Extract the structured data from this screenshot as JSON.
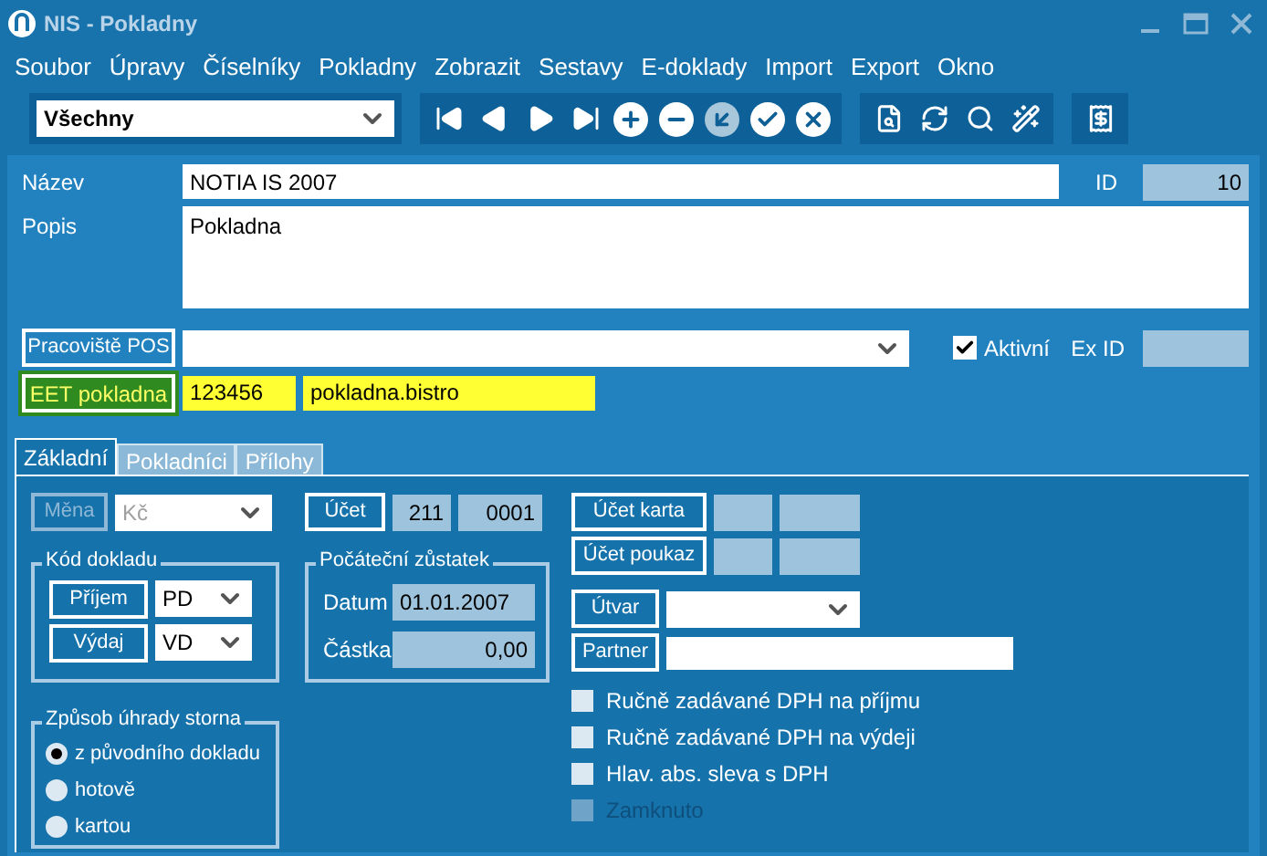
{
  "window": {
    "title": "NIS - Pokladny"
  },
  "menu": [
    "Soubor",
    "Úpravy",
    "Číselníky",
    "Pokladny",
    "Zobrazit",
    "Sestavy",
    "E-doklady",
    "Import",
    "Export",
    "Okno"
  ],
  "toolbar": {
    "filter": "Všechny",
    "groups": [
      [
        {
          "kind": "first",
          "disabled": false
        },
        {
          "kind": "prev",
          "disabled": false
        },
        {
          "kind": "next",
          "disabled": false
        },
        {
          "kind": "last",
          "disabled": false
        },
        {
          "kind": "add",
          "disabled": false
        },
        {
          "kind": "remove",
          "disabled": false
        },
        {
          "kind": "edit",
          "disabled": true
        },
        {
          "kind": "confirm",
          "disabled": false
        },
        {
          "kind": "cancel",
          "disabled": false
        }
      ],
      [
        {
          "kind": "preview",
          "disabled": false
        },
        {
          "kind": "refresh",
          "disabled": false
        },
        {
          "kind": "find",
          "disabled": false
        },
        {
          "kind": "wand",
          "disabled": false
        }
      ],
      [
        {
          "kind": "receipt",
          "disabled": false
        }
      ]
    ]
  },
  "form": {
    "name_label": "Název",
    "name_value": "NOTIA IS 2007",
    "id_label": "ID",
    "id_value": "10",
    "description_label": "Popis",
    "description_value": "Pokladna",
    "workplace_button": "Pracoviště POS",
    "active": {
      "label": "Aktivní",
      "checked": true
    },
    "ex_id_label": "Ex ID",
    "eet_button": "EET pokladna",
    "eet_highlighted": true,
    "eet_values": [
      "123456",
      "pokladna.bistro"
    ]
  },
  "tabs": [
    {
      "label": "Základní",
      "selected": true
    },
    {
      "label": "Pokladníci",
      "selected": false
    },
    {
      "label": "Přílohy",
      "selected": false
    }
  ],
  "basic": {
    "currency": {
      "label": "Měna",
      "value": "Kč",
      "disabled": true
    },
    "account": {
      "label": "Účet",
      "values": [
        "211",
        "0001"
      ]
    },
    "card_account": {
      "label": "Účet karta"
    },
    "voucher_account": {
      "label": "Účet poukaz"
    },
    "document_code": {
      "title": "Kód dokladu",
      "rows": [
        {
          "label": "Příjem",
          "value": "PD"
        },
        {
          "label": "Výdaj",
          "value": "VD"
        }
      ]
    },
    "opening_balance": {
      "title": "Počáteční zůstatek",
      "date_label": "Datum",
      "date_value": "01.01.2007",
      "amount_label": "Částka",
      "amount_value": "0,00"
    },
    "department": {
      "label": "Útvar"
    },
    "partner": {
      "label": "Partner"
    },
    "checkboxes": [
      {
        "label": "Ručně zadávané DPH na příjmu",
        "checked": false,
        "disabled": false
      },
      {
        "label": "Ručně zadávané DPH na výdeji",
        "checked": false,
        "disabled": false
      },
      {
        "label": "Hlav. abs. sleva s DPH",
        "checked": false,
        "disabled": false
      },
      {
        "label": "Zamknuto",
        "checked": false,
        "disabled": true
      }
    ],
    "storno": {
      "title": "Způsob úhrady storna",
      "options": [
        {
          "label": "z původního dokladu",
          "selected": true
        },
        {
          "label": "hotově",
          "selected": false
        },
        {
          "label": "kartou",
          "selected": false
        }
      ]
    }
  }
}
